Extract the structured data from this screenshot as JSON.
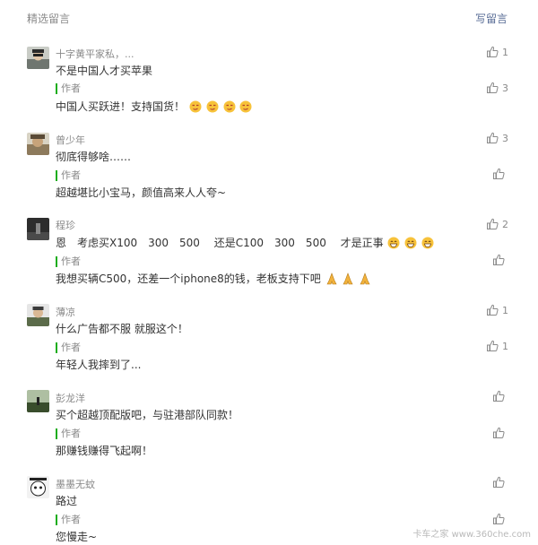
{
  "header": {
    "title": "精选留言",
    "write_label": "写留言"
  },
  "comments": [
    {
      "nick": "十字黄平家私，...",
      "text": "不是中国人才买苹果",
      "likes": "1",
      "reply": {
        "label": "作者",
        "text": "中国人买跃进！支持国货！",
        "likes": "3",
        "emoji": "smug-face-icon",
        "emoji_count": 4
      }
    },
    {
      "nick": "曾少年",
      "text": "彻底得够啥……",
      "likes": "3",
      "reply": {
        "label": "作者",
        "text": "超越堪比小宝马，颜值高来人人夸~",
        "likes": ""
      }
    },
    {
      "nick": "程珍",
      "text": "恩　考虑买X100　300　500　 还是C100　300　500　 才是正事",
      "likes": "2",
      "emoji": "grinning-face-icon",
      "emoji_count": 3,
      "reply": {
        "label": "作者",
        "text": "我想买辆C500，还差一个iphone8的钱，老板支持下吧",
        "likes": "",
        "emoji": "praying-hands-icon",
        "emoji_count": 3
      }
    },
    {
      "nick": "薄凉",
      "text": "什么广告都不服 就服这个！",
      "likes": "1",
      "reply": {
        "label": "作者",
        "text": "年轻人我摔到了...",
        "likes": "1"
      }
    },
    {
      "nick": "彭龙洋",
      "text": "买个超越顶配版吧，与驻港部队同款！",
      "likes": "",
      "reply": {
        "label": "作者",
        "text": "那赚钱赚得飞起啊！",
        "likes": ""
      }
    },
    {
      "nick": "墨墨无蚊",
      "text": "路过",
      "likes": "",
      "reply": {
        "label": "作者",
        "text": "您慢走~",
        "likes": ""
      }
    }
  ],
  "watermark": "卡车之家 www.360che.com",
  "colors": {
    "accent_link": "#576b95",
    "author_bar": "#1aad19",
    "muted": "#8a8a8a"
  }
}
